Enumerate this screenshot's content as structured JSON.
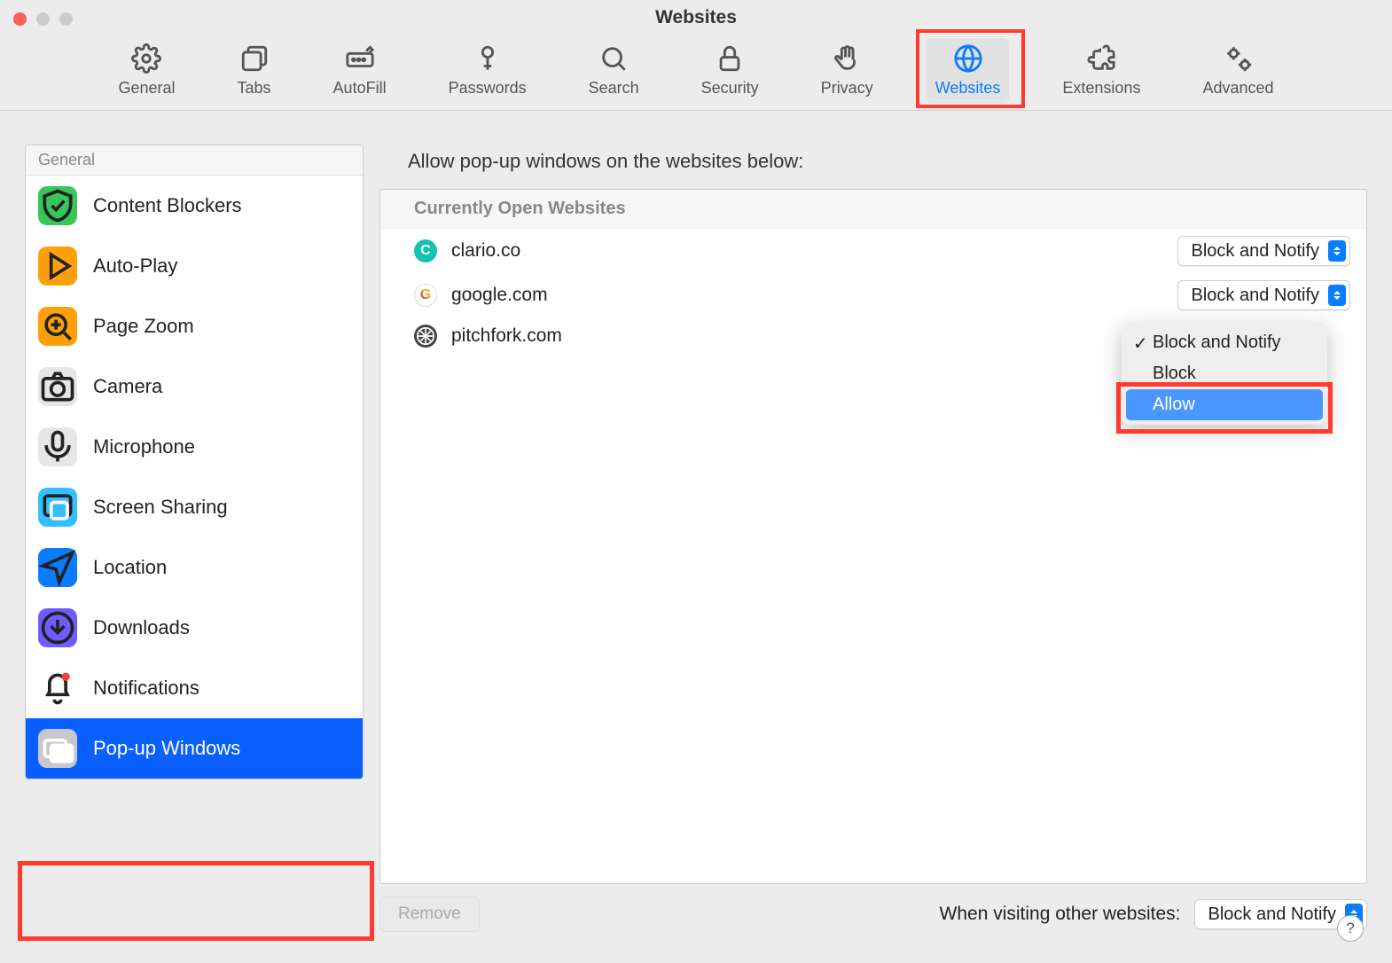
{
  "window": {
    "title": "Websites"
  },
  "toolbar": [
    {
      "label": "General",
      "icon": "gear-icon",
      "active": false
    },
    {
      "label": "Tabs",
      "icon": "tabs-icon",
      "active": false
    },
    {
      "label": "AutoFill",
      "icon": "autofill-icon",
      "active": false
    },
    {
      "label": "Passwords",
      "icon": "key-icon",
      "active": false
    },
    {
      "label": "Search",
      "icon": "search-icon",
      "active": false
    },
    {
      "label": "Security",
      "icon": "lock-icon",
      "active": false
    },
    {
      "label": "Privacy",
      "icon": "hand-icon",
      "active": false
    },
    {
      "label": "Websites",
      "icon": "globe-icon",
      "active": true
    },
    {
      "label": "Extensions",
      "icon": "puzzle-icon",
      "active": false
    },
    {
      "label": "Advanced",
      "icon": "gears-icon",
      "active": false
    }
  ],
  "sidebar": {
    "header": "General",
    "items": [
      {
        "label": "Content Blockers",
        "icon": "shield-check-icon",
        "color": "#37c759",
        "selected": false
      },
      {
        "label": "Auto-Play",
        "icon": "play-icon",
        "color": "#ff9f0a",
        "selected": false
      },
      {
        "label": "Page Zoom",
        "icon": "zoom-icon",
        "color": "#ff9f0a",
        "selected": false
      },
      {
        "label": "Camera",
        "icon": "camera-icon",
        "color": "#e6e6e6",
        "selected": false
      },
      {
        "label": "Microphone",
        "icon": "mic-icon",
        "color": "#e6e6e6",
        "selected": false
      },
      {
        "label": "Screen Sharing",
        "icon": "screen-icon",
        "color": "#34c0ff",
        "selected": false
      },
      {
        "label": "Location",
        "icon": "location-icon",
        "color": "#0a7cff",
        "selected": false
      },
      {
        "label": "Downloads",
        "icon": "download-icon",
        "color": "#6f5cff",
        "selected": false
      },
      {
        "label": "Notifications",
        "icon": "bell-icon",
        "color": "#ffffff",
        "selected": false
      },
      {
        "label": "Pop-up Windows",
        "icon": "popup-icon",
        "color": "#c8c8cc",
        "selected": true
      }
    ]
  },
  "main": {
    "heading": "Allow pop-up windows on the websites below:",
    "section": "Currently Open Websites",
    "sites": [
      {
        "domain": "clario.co",
        "favicon_bg": "#13c2b3",
        "favicon_letter": "C",
        "setting": "Block and Notify"
      },
      {
        "domain": "google.com",
        "favicon_bg": "#ffffff",
        "favicon_letter": "G",
        "setting": "Block and Notify"
      },
      {
        "domain": "pitchfork.com",
        "favicon_bg": "#444",
        "favicon_letter": "",
        "setting": "Block and Notify"
      }
    ],
    "menu_options": [
      "Block and Notify",
      "Block",
      "Allow"
    ],
    "menu_checked": "Block and Notify",
    "menu_hover": "Allow",
    "remove_label": "Remove",
    "footer_label": "When visiting other websites:",
    "footer_value": "Block and Notify"
  },
  "help_label": "?"
}
